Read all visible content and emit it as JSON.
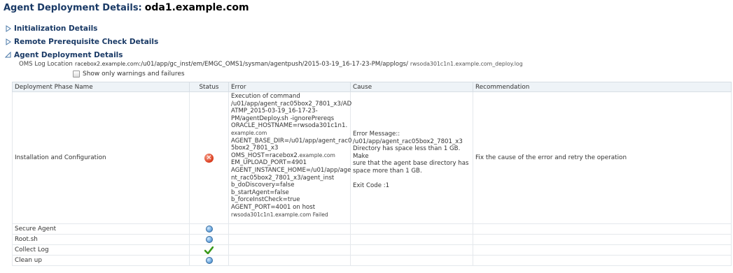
{
  "page": {
    "title": "Agent Deployment Details:",
    "host": "oda1.example.com"
  },
  "sections": [
    {
      "label": "Initialization Details",
      "expanded": false
    },
    {
      "label": "Remote Prerequisite Check Details",
      "expanded": false
    },
    {
      "label": "Agent Deployment Details",
      "expanded": true
    }
  ],
  "log": {
    "label": "OMS Log Location",
    "host_prefix": "racebox2.example.com",
    "path": ":/u01/app/gc_inst/em/EMGC_OMS1/sysman/agentpush/2015-03-19_16-17-23-PM/applogs/",
    "file": "rwsoda301c1n1.example.com_deploy.log"
  },
  "filter": {
    "label": "Show only warnings and failures",
    "checked": false
  },
  "table": {
    "headers": {
      "phase": "Deployment Phase Name",
      "status": "Status",
      "error": "Error",
      "cause": "Cause",
      "recommendation": "Recommendation"
    },
    "rows": [
      {
        "phase": "Installation and Configuration",
        "status": "error",
        "error_main": "Execution of command\n/u01/app/agent_rac05box2_7801_x3/AD\nATMP_2015-03-19_16-17-23-\nPM/agentDeploy.sh -ignorePrereqs\nORACLE_HOSTNAME=rwsoda301c1n1.",
        "error_host1": "example.com",
        "error_mid": "AGENT_BASE_DIR=/u01/app/agent_rac0\n5box2_7801_x3\nOMS_HOST=racebox2.",
        "error_host2": "example.com",
        "error_rest": "EM_UPLOAD_PORT=4901\nAGENT_INSTANCE_HOME=/u01/app/age\nnt_rac05box2_7801_x3/agent_inst\nb_doDiscovery=false\nb_startAgent=false\nb_forceInstCheck=true\nAGENT_PORT=4001 on host",
        "error_tail": "rwsoda301c1n1.example.com Failed",
        "cause": "Error Message::\n/u01/app/agent_rac05box2_7801_x3\nDirectory has space less than 1 GB. Make\nsure that the agent base directory has\nspace more than 1 GB.\n\nExit Code :1",
        "recommendation": "Fix the cause of the error and retry the operation"
      },
      {
        "phase": "Secure Agent",
        "status": "pending",
        "cause": "",
        "recommendation": ""
      },
      {
        "phase": "Root.sh",
        "status": "pending",
        "cause": "",
        "recommendation": ""
      },
      {
        "phase": "Collect Log",
        "status": "success",
        "cause": "",
        "recommendation": ""
      },
      {
        "phase": "Clean up",
        "status": "pending",
        "cause": "",
        "recommendation": ""
      }
    ]
  },
  "colors": {
    "title": "#1a3a66",
    "error": "#d9391a",
    "success": "#3a9a1a",
    "pending": "#5a9bd8"
  }
}
